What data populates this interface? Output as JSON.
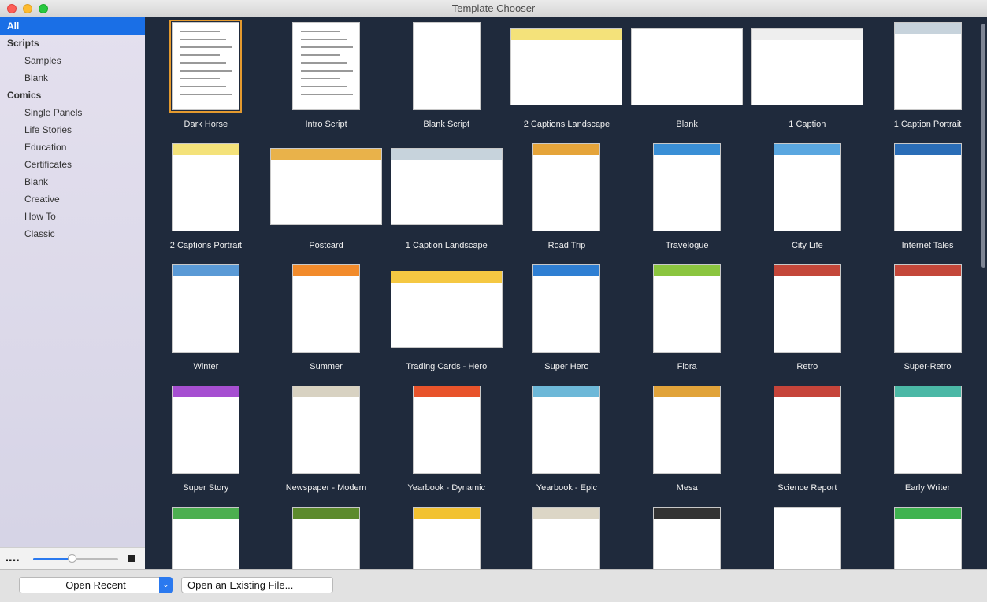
{
  "window": {
    "title": "Template Chooser"
  },
  "sidebar": {
    "items": [
      {
        "label": "All",
        "kind": "selected"
      },
      {
        "label": "Scripts",
        "kind": "group"
      },
      {
        "label": "Samples",
        "kind": "sub"
      },
      {
        "label": "Blank",
        "kind": "sub"
      },
      {
        "label": "Comics",
        "kind": "group"
      },
      {
        "label": "Single Panels",
        "kind": "sub"
      },
      {
        "label": "Life Stories",
        "kind": "sub"
      },
      {
        "label": "Education",
        "kind": "sub"
      },
      {
        "label": "Certificates",
        "kind": "sub"
      },
      {
        "label": "Blank",
        "kind": "sub"
      },
      {
        "label": "Creative",
        "kind": "sub"
      },
      {
        "label": "How To",
        "kind": "sub"
      },
      {
        "label": "Classic",
        "kind": "sub"
      }
    ],
    "zoom_slider": {
      "value": 0.45
    }
  },
  "templates": [
    {
      "label": "Dark Horse",
      "accent": "#ffffff"
    },
    {
      "label": "Intro Script",
      "accent": "#ffffff"
    },
    {
      "label": "Blank Script",
      "accent": "#ffffff"
    },
    {
      "label": "2 Captions Landscape",
      "accent": "#f4e27a"
    },
    {
      "label": "Blank",
      "accent": "#ffffff"
    },
    {
      "label": "1 Caption",
      "accent": "#eeeeee"
    },
    {
      "label": "1 Caption Portrait",
      "accent": "#c7d3dc"
    },
    {
      "label": "2 Captions Portrait",
      "accent": "#f4e27a"
    },
    {
      "label": "Postcard",
      "accent": "#e9b24a"
    },
    {
      "label": "1 Caption Landscape",
      "accent": "#c7d3dc"
    },
    {
      "label": "Road Trip",
      "accent": "#e5a43a"
    },
    {
      "label": "Travelogue",
      "accent": "#3a8fd6"
    },
    {
      "label": "City Life",
      "accent": "#5aa7e0"
    },
    {
      "label": "Internet Tales",
      "accent": "#2a6db7"
    },
    {
      "label": "Winter",
      "accent": "#5a9ad6"
    },
    {
      "label": "Summer",
      "accent": "#f28b2b"
    },
    {
      "label": "Trading Cards - Hero",
      "accent": "#f5c842"
    },
    {
      "label": "Super Hero",
      "accent": "#2f7fd3"
    },
    {
      "label": "Flora",
      "accent": "#8bc53f"
    },
    {
      "label": "Retro",
      "accent": "#c4473a"
    },
    {
      "label": "Super-Retro",
      "accent": "#c4473a"
    },
    {
      "label": "Super Story",
      "accent": "#a64fd1"
    },
    {
      "label": "Newspaper - Modern",
      "accent": "#d8d2c2"
    },
    {
      "label": "Yearbook - Dynamic",
      "accent": "#e8532b"
    },
    {
      "label": "Yearbook - Epic",
      "accent": "#6db8d8"
    },
    {
      "label": "Mesa",
      "accent": "#e1a33a"
    },
    {
      "label": "Science Report",
      "accent": "#c6443a"
    },
    {
      "label": "Early Writer",
      "accent": "#4bb8a6"
    },
    {
      "label": "",
      "accent": "#4caf50"
    },
    {
      "label": "",
      "accent": "#5c8a2c"
    },
    {
      "label": "",
      "accent": "#f2c230"
    },
    {
      "label": "",
      "accent": "#dcd6c6"
    },
    {
      "label": "",
      "accent": "#333333"
    },
    {
      "label": "",
      "accent": "#ffffff"
    },
    {
      "label": "",
      "accent": "#3fb34f"
    }
  ],
  "footer": {
    "open_recent": "Open Recent",
    "open_existing": "Open an Existing File..."
  }
}
